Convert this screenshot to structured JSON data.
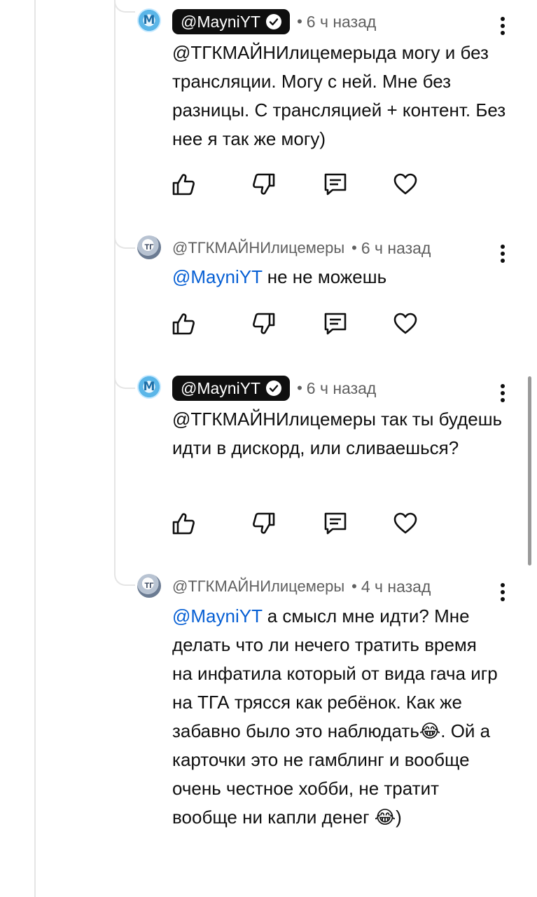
{
  "comments": [
    {
      "author": "@MayniYT",
      "verified": true,
      "time": "6 ч назад",
      "text_prefix": "",
      "text": "@ТГКМАЙНИлицемерыда могу и без трансляции. Могу с ней. Мне без разницы. С трансляцией + контент. Без нее я так же могу)"
    },
    {
      "author": "@ТГКМАЙНИлицемеры",
      "verified": false,
      "time": "6 ч назад",
      "mention": "@MayniYT",
      "text": " не не можешь"
    },
    {
      "author": "@MayniYT",
      "verified": true,
      "time": "6 ч назад",
      "text": "@ТГКМАЙНИлицемеры так ты будешь идти в дискорд, или сливаешься?"
    },
    {
      "author": "@ТГКМАЙНИлицемеры",
      "verified": false,
      "time": "4 ч назад",
      "mention": "@MayniYT",
      "text": " а смысл мне идти? Мне делать что ли нечего тратить время на инфатила который от вида гача игр на ТГА трясся как ребёнок. Как же забавно было это наблюдать😂. Ой а карточки это не гамблинг и вообще очень честное хобби, не тратит вообще ни капли денег 😂)"
    }
  ],
  "separator": "•",
  "icons": [
    "like-icon",
    "dislike-icon",
    "reply-icon",
    "heart-icon",
    "more-vert-icon",
    "verified-check-icon"
  ],
  "colors": {
    "mention": "#065fd4",
    "meta": "#606060",
    "badge_bg": "#0f0f0f"
  }
}
